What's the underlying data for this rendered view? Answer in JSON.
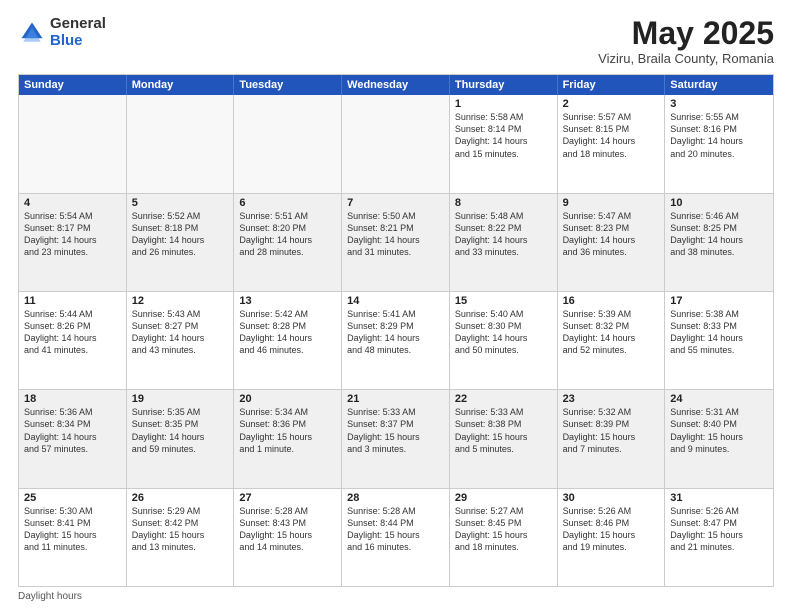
{
  "logo": {
    "general": "General",
    "blue": "Blue"
  },
  "title": "May 2025",
  "location": "Viziru, Braila County, Romania",
  "header_days": [
    "Sunday",
    "Monday",
    "Tuesday",
    "Wednesday",
    "Thursday",
    "Friday",
    "Saturday"
  ],
  "footer": "Daylight hours",
  "weeks": [
    [
      {
        "day": "",
        "empty": true
      },
      {
        "day": "",
        "empty": true
      },
      {
        "day": "",
        "empty": true
      },
      {
        "day": "",
        "empty": true
      },
      {
        "day": "1",
        "lines": [
          "Sunrise: 5:58 AM",
          "Sunset: 8:14 PM",
          "Daylight: 14 hours",
          "and 15 minutes."
        ]
      },
      {
        "day": "2",
        "lines": [
          "Sunrise: 5:57 AM",
          "Sunset: 8:15 PM",
          "Daylight: 14 hours",
          "and 18 minutes."
        ]
      },
      {
        "day": "3",
        "lines": [
          "Sunrise: 5:55 AM",
          "Sunset: 8:16 PM",
          "Daylight: 14 hours",
          "and 20 minutes."
        ]
      }
    ],
    [
      {
        "day": "4",
        "lines": [
          "Sunrise: 5:54 AM",
          "Sunset: 8:17 PM",
          "Daylight: 14 hours",
          "and 23 minutes."
        ]
      },
      {
        "day": "5",
        "lines": [
          "Sunrise: 5:52 AM",
          "Sunset: 8:18 PM",
          "Daylight: 14 hours",
          "and 26 minutes."
        ]
      },
      {
        "day": "6",
        "lines": [
          "Sunrise: 5:51 AM",
          "Sunset: 8:20 PM",
          "Daylight: 14 hours",
          "and 28 minutes."
        ]
      },
      {
        "day": "7",
        "lines": [
          "Sunrise: 5:50 AM",
          "Sunset: 8:21 PM",
          "Daylight: 14 hours",
          "and 31 minutes."
        ]
      },
      {
        "day": "8",
        "lines": [
          "Sunrise: 5:48 AM",
          "Sunset: 8:22 PM",
          "Daylight: 14 hours",
          "and 33 minutes."
        ]
      },
      {
        "day": "9",
        "lines": [
          "Sunrise: 5:47 AM",
          "Sunset: 8:23 PM",
          "Daylight: 14 hours",
          "and 36 minutes."
        ]
      },
      {
        "day": "10",
        "lines": [
          "Sunrise: 5:46 AM",
          "Sunset: 8:25 PM",
          "Daylight: 14 hours",
          "and 38 minutes."
        ]
      }
    ],
    [
      {
        "day": "11",
        "lines": [
          "Sunrise: 5:44 AM",
          "Sunset: 8:26 PM",
          "Daylight: 14 hours",
          "and 41 minutes."
        ]
      },
      {
        "day": "12",
        "lines": [
          "Sunrise: 5:43 AM",
          "Sunset: 8:27 PM",
          "Daylight: 14 hours",
          "and 43 minutes."
        ]
      },
      {
        "day": "13",
        "lines": [
          "Sunrise: 5:42 AM",
          "Sunset: 8:28 PM",
          "Daylight: 14 hours",
          "and 46 minutes."
        ]
      },
      {
        "day": "14",
        "lines": [
          "Sunrise: 5:41 AM",
          "Sunset: 8:29 PM",
          "Daylight: 14 hours",
          "and 48 minutes."
        ]
      },
      {
        "day": "15",
        "lines": [
          "Sunrise: 5:40 AM",
          "Sunset: 8:30 PM",
          "Daylight: 14 hours",
          "and 50 minutes."
        ]
      },
      {
        "day": "16",
        "lines": [
          "Sunrise: 5:39 AM",
          "Sunset: 8:32 PM",
          "Daylight: 14 hours",
          "and 52 minutes."
        ]
      },
      {
        "day": "17",
        "lines": [
          "Sunrise: 5:38 AM",
          "Sunset: 8:33 PM",
          "Daylight: 14 hours",
          "and 55 minutes."
        ]
      }
    ],
    [
      {
        "day": "18",
        "lines": [
          "Sunrise: 5:36 AM",
          "Sunset: 8:34 PM",
          "Daylight: 14 hours",
          "and 57 minutes."
        ]
      },
      {
        "day": "19",
        "lines": [
          "Sunrise: 5:35 AM",
          "Sunset: 8:35 PM",
          "Daylight: 14 hours",
          "and 59 minutes."
        ]
      },
      {
        "day": "20",
        "lines": [
          "Sunrise: 5:34 AM",
          "Sunset: 8:36 PM",
          "Daylight: 15 hours",
          "and 1 minute."
        ]
      },
      {
        "day": "21",
        "lines": [
          "Sunrise: 5:33 AM",
          "Sunset: 8:37 PM",
          "Daylight: 15 hours",
          "and 3 minutes."
        ]
      },
      {
        "day": "22",
        "lines": [
          "Sunrise: 5:33 AM",
          "Sunset: 8:38 PM",
          "Daylight: 15 hours",
          "and 5 minutes."
        ]
      },
      {
        "day": "23",
        "lines": [
          "Sunrise: 5:32 AM",
          "Sunset: 8:39 PM",
          "Daylight: 15 hours",
          "and 7 minutes."
        ]
      },
      {
        "day": "24",
        "lines": [
          "Sunrise: 5:31 AM",
          "Sunset: 8:40 PM",
          "Daylight: 15 hours",
          "and 9 minutes."
        ]
      }
    ],
    [
      {
        "day": "25",
        "lines": [
          "Sunrise: 5:30 AM",
          "Sunset: 8:41 PM",
          "Daylight: 15 hours",
          "and 11 minutes."
        ]
      },
      {
        "day": "26",
        "lines": [
          "Sunrise: 5:29 AM",
          "Sunset: 8:42 PM",
          "Daylight: 15 hours",
          "and 13 minutes."
        ]
      },
      {
        "day": "27",
        "lines": [
          "Sunrise: 5:28 AM",
          "Sunset: 8:43 PM",
          "Daylight: 15 hours",
          "and 14 minutes."
        ]
      },
      {
        "day": "28",
        "lines": [
          "Sunrise: 5:28 AM",
          "Sunset: 8:44 PM",
          "Daylight: 15 hours",
          "and 16 minutes."
        ]
      },
      {
        "day": "29",
        "lines": [
          "Sunrise: 5:27 AM",
          "Sunset: 8:45 PM",
          "Daylight: 15 hours",
          "and 18 minutes."
        ]
      },
      {
        "day": "30",
        "lines": [
          "Sunrise: 5:26 AM",
          "Sunset: 8:46 PM",
          "Daylight: 15 hours",
          "and 19 minutes."
        ]
      },
      {
        "day": "31",
        "lines": [
          "Sunrise: 5:26 AM",
          "Sunset: 8:47 PM",
          "Daylight: 15 hours",
          "and 21 minutes."
        ]
      }
    ]
  ]
}
